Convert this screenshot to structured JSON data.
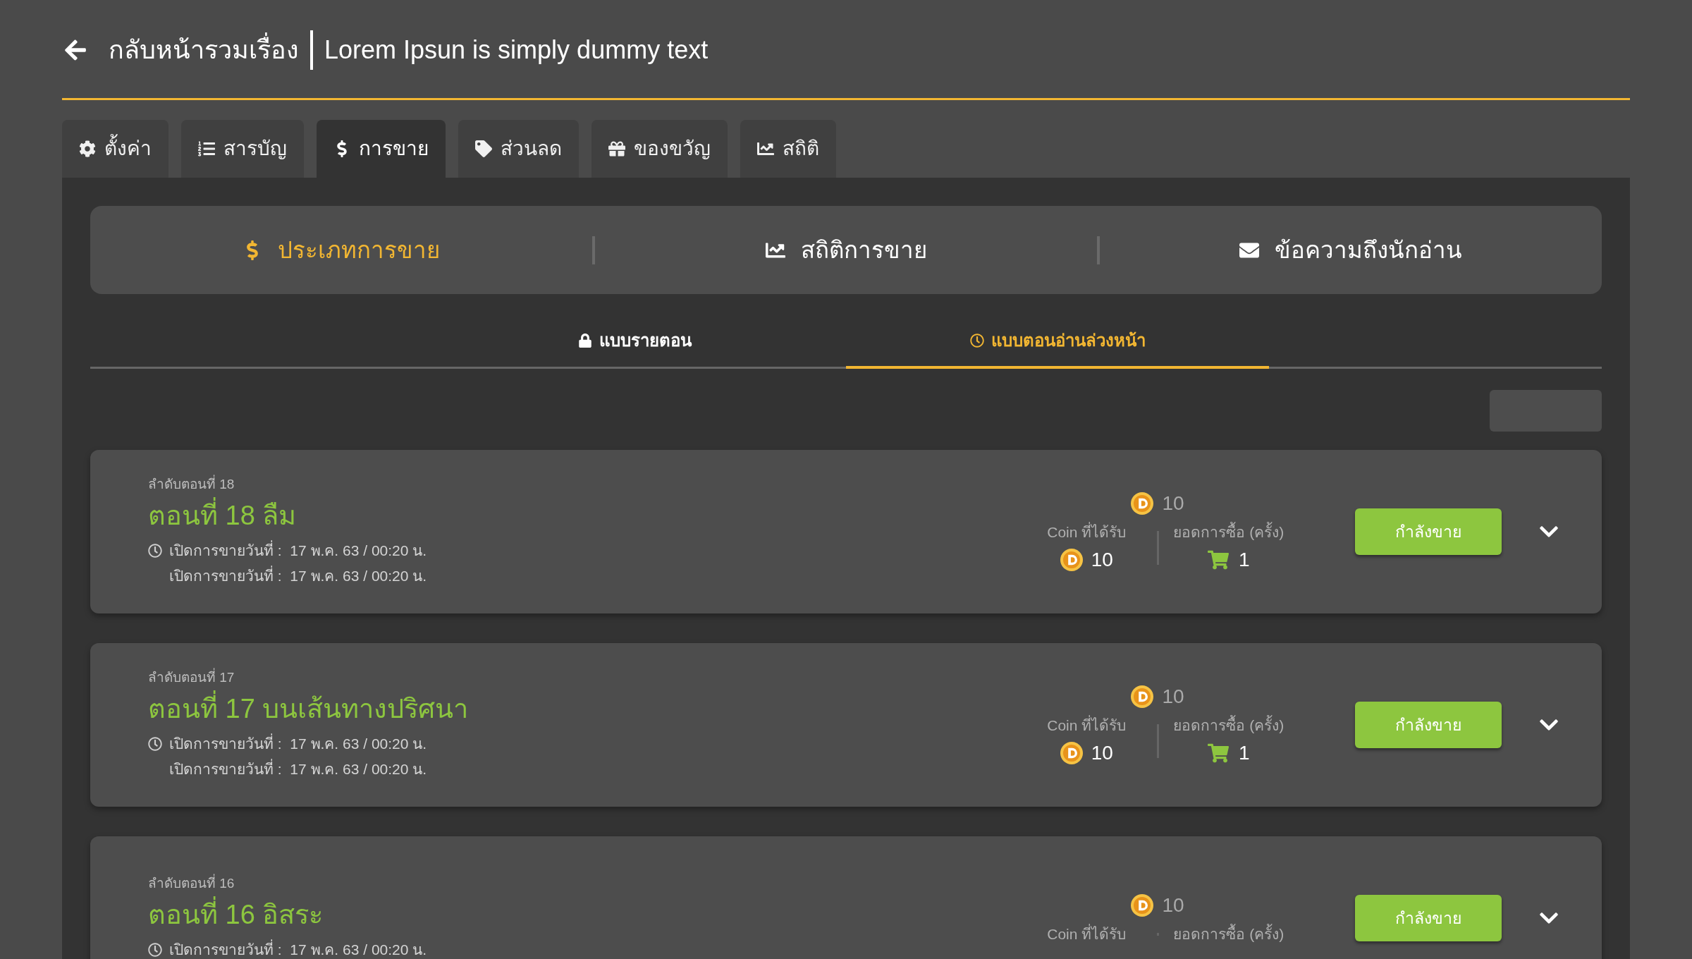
{
  "header": {
    "back_label": "กลับหน้ารวมเรื่อง",
    "title": "Lorem Ipsun is simply dummy text"
  },
  "tabs": [
    {
      "label": "ตั้งค่า",
      "selected": false
    },
    {
      "label": "สารบัญ",
      "selected": false
    },
    {
      "label": "การขาย",
      "selected": true
    },
    {
      "label": "ส่วนลด",
      "selected": false
    },
    {
      "label": "ของขวัญ",
      "selected": false
    },
    {
      "label": "สถิติ",
      "selected": false
    }
  ],
  "section_tabs": [
    {
      "label": "ประเภทการขาย",
      "selected": true
    },
    {
      "label": "สถิติการขาย",
      "selected": false
    },
    {
      "label": "ข้อความถึงนักอ่าน",
      "selected": false
    }
  ],
  "sub_tabs": [
    {
      "label": "แบบรายตอน",
      "selected": false
    },
    {
      "label": "แบบตอนอ่านล่วงหน้า",
      "selected": true
    }
  ],
  "episodes": [
    {
      "order_label": "ลำดับตอนที่ 18",
      "title": "ตอนที่ 18 ลืม",
      "sale_dates": [
        "เปิดการขายวันที่ :  17 พ.ค. 63 / 00:20 น.",
        "เปิดการขายวันที่ :  17 พ.ค. 63 / 00:20 น."
      ],
      "price": "10",
      "coin_label": "Coin ที่ได้รับ",
      "coin_value": "10",
      "purchase_label": "ยอดการซื้อ (ครั้ง)",
      "purchase_value": "1",
      "status": "กำลังขาย"
    },
    {
      "order_label": "ลำดับตอนที่ 17",
      "title": "ตอนที่ 17 บนเส้นทางปริศนา",
      "sale_dates": [
        "เปิดการขายวันที่ :  17 พ.ค. 63 / 00:20 น.",
        "เปิดการขายวันที่ :  17 พ.ค. 63 / 00:20 น."
      ],
      "price": "10",
      "coin_label": "Coin ที่ได้รับ",
      "coin_value": "10",
      "purchase_label": "ยอดการซื้อ (ครั้ง)",
      "purchase_value": "1",
      "status": "กำลังขาย"
    },
    {
      "order_label": "ลำดับตอนที่ 16",
      "title": "ตอนที่ 16 อิสระ",
      "sale_dates": [
        "เปิดการขายวันที่ :  17 พ.ค. 63 / 00:20 น."
      ],
      "price": "10",
      "coin_label": "Coin ที่ได้รับ",
      "purchase_label": "ยอดการซื้อ (ครั้ง)",
      "status": "กำลังขาย"
    }
  ]
}
